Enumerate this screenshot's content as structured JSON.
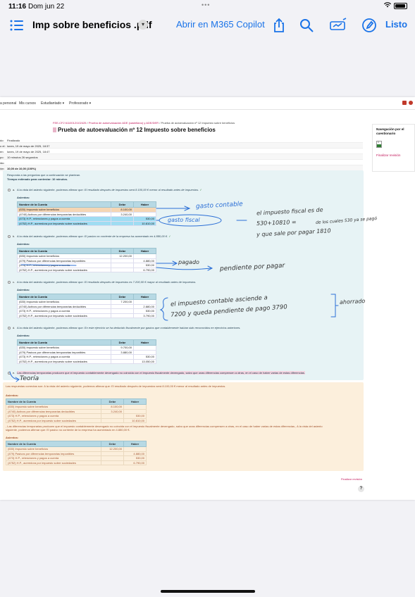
{
  "status_bar": {
    "time": "11:16",
    "date": "Dom jun 22",
    "dots": "•••"
  },
  "toolbar": {
    "doc_title": "Imp sobre beneficios .pdf",
    "open_in": "Abrir en M365 Copilot",
    "done": "Listo",
    "icons": [
      "list-icon",
      "chevron-down-icon",
      "share-icon",
      "search-icon",
      "markup-icon",
      "pencil-icon"
    ]
  },
  "moodle_nav": {
    "items": [
      "a personal",
      "Mis cursos",
      "Estudiantado ▾",
      "Profesorado ▾"
    ]
  },
  "breadcrumb": {
    "course": "FEE-CF2 6110012/102425",
    "section": "Prueba de autoevaluación ADE (castellano) y ADE/DER",
    "current": "Prueba de autoevaluación nº 12 Impuesto sobre beneficios",
    "sep": "/"
  },
  "quiz_title": "Prueba de autoevaluación nº 12 Impuesto sobre beneficios",
  "info": [
    {
      "k": "do:",
      "v": "Finalizado"
    },
    {
      "k": "o el:",
      "v": "lunes, 19 de mayo de 2025, 18:37"
    },
    {
      "k": "en:",
      "v": "lunes, 19 de mayo de 2025, 18:47"
    },
    {
      "k": "po:",
      "v": "10 minutos 26 segundos"
    },
    {
      "k": "ido:",
      "v": ""
    },
    {
      "k": "ión:",
      "v": "10,00 de 10,00 (100%)"
    }
  ],
  "side": {
    "title": "Navegación por el cuestionario",
    "num": "1",
    "finish": "Finalizar revisión"
  },
  "question": {
    "intro": "Responda a las preguntas que a continuación se plantean.",
    "time": "Tiempo estimado para contestar: 10 minutos.",
    "asientos": "Asientos:",
    "headers": [
      "Nombre de la Cuenta",
      "Debe",
      "Haber"
    ],
    "options": [
      {
        "letter": "a.",
        "prefix": "A la vista del asiento siguiente, podemos afirmar que:",
        "text": "El resultado después de impuestos será 8.100,00 € menor al resultado antes de impuestos.",
        "rows": [
          [
            "(630) Impuesto sobre beneficios",
            "8.100,00",
            ""
          ],
          [
            "(4740) Activos por diferencias temporarias deducibles",
            "3.240,00",
            ""
          ],
          [
            "(473) H.P., retenciones y pagos a cuenta",
            "",
            "530,00"
          ],
          [
            "(4752) H.P., acreedora por impuesto sobre sociedades",
            "",
            "10.810,00"
          ]
        ]
      },
      {
        "letter": "b.",
        "prefix": "A la vista del asiento siguiente, podemos afirmar que:",
        "text": "El pasivo no corriente de la empresa ha aumentado en 4.880,00 €.",
        "rows": [
          [
            "(630) Impuesto sobre beneficios",
            "12.200,00",
            ""
          ],
          [
            "(479) Pasivos por diferencias temporarias imponibles",
            "",
            "4.880,00"
          ],
          [
            "(473) H.P., retenciones y pagos a cuenta",
            "",
            "530,00"
          ],
          [
            "(4752) H.P., acreedora por impuesto sobre sociedades",
            "",
            "6.790,00"
          ]
        ]
      },
      {
        "letter": "c.",
        "prefix": "A la vista del asiento siguiente, podemos afirmar que:",
        "text": "El resultado después de impuestos es 7.200,00 € mayor al resultado antes de impuestos.",
        "rows": [
          [
            "(630) Impuesto sobre beneficios",
            "7.200,00",
            ""
          ],
          [
            "(4740) Activos por diferencias temporarias deducibles",
            "",
            "2.880,00"
          ],
          [
            "(473) H.P., retenciones y pagos a cuenta",
            "",
            "530,00"
          ],
          [
            "(4752) H.P., acreedora por impuesto sobre sociedades",
            "",
            "3.790,00"
          ]
        ]
      },
      {
        "letter": "d.",
        "prefix": "A la vista del asiento siguiente, podemos afirmar que:",
        "text": "En este ejercicio se ha deducido fiscalmente por gastos que contablemente habían sido reconocidos en ejercicios anteriores.",
        "rows": [
          [
            "(630) Impuesto sobre beneficios",
            "9.700,00",
            ""
          ],
          [
            "(479) Pasivos por diferencias temporarias imponibles",
            "3.880,00",
            ""
          ],
          [
            "(473) H.P., retenciones y pagos a cuenta",
            "",
            "530,00"
          ],
          [
            "(4752) H.P., acreedora por impuesto sobre sociedades",
            "",
            "13.050,00"
          ]
        ]
      },
      {
        "letter": "e.",
        "text": "Las diferencias temporarias producen que el impuesto contablemente devengado no coincida con el impuesto fiscalmente devengado, salvo que unas diferencias compensen a otras, en el caso de haber varias de estas diferencias."
      }
    ]
  },
  "feedback": {
    "correct_intro": "Las respuestas correctas son: A la vista del asiento siguiente, podemos afirmar que: El resultado después de impuestos será 8.100,00 € menor al resultado antes de impuestos.",
    "asientos": "Asientos:",
    "table1": [
      [
        "(630) Impuesto sobre beneficios",
        "8.100,00",
        ""
      ],
      [
        "(4740) Activos por diferencias temporarias deducibles",
        "3.240,00",
        ""
      ],
      [
        "(473) H.P., retenciones y pagos a cuenta",
        "",
        "530,00"
      ],
      [
        "(4752) H.P., acreedora por impuesto sobre sociedades",
        "",
        "10.810,00"
      ]
    ],
    "middle_1": ", Las diferencias temporarias producen que el impuesto contablemente devengado no coincida con el impuesto fiscalmente devengado, salvo que unas diferencias compensen a otras, en el caso de haber varias de estas diferencias., A la vista del asiento",
    "middle_2": "siguiente, podemos afirmar que: El pasivo no corriente de la empresa ha aumentado en 4.880,00 €.",
    "table2": [
      [
        "(630) Impuesto sobre beneficios",
        "12.200,00",
        ""
      ],
      [
        "(479) Pasivos por diferencias temporarias imponibles",
        "",
        "4.880,00"
      ],
      [
        "(473) H.P., retenciones y pagos a cuenta",
        "",
        "530,00"
      ],
      [
        "(4752) H.P., acreedora por impuesto sobre sociedades",
        "",
        "6.790,00"
      ]
    ],
    "finish": "Finalizar revisión",
    "help": "?"
  },
  "handwriting": {
    "n1": "gasto contable",
    "n2": "gasto fiscal",
    "n3a": "el impuesto fiscal es de",
    "n3b": "530+10810 =",
    "n3c": "de los cuales 530 ya se pagó",
    "n3d": "y que sale por pagar 1810",
    "n4": "pagado",
    "n5": "pendiente por pagar",
    "n6a": "el impuesto contable asciende a",
    "n6b": "7200   y queda pendiente de pago 3790",
    "n7": "ahorrado",
    "n8": "Teoría"
  },
  "colors": {
    "accent": "#1a73e8",
    "ink": "#2b6fd6",
    "question_bg": "#e7f3f5",
    "feedback_bg": "#fcefdc",
    "link": "#c2185b"
  }
}
